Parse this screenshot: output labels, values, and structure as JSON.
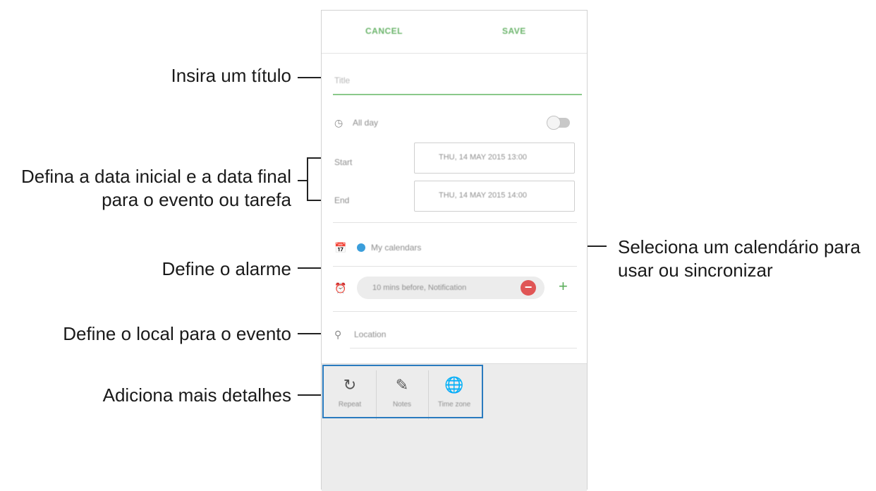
{
  "callouts": {
    "title": "Insira um título",
    "dates_line1": "Defina a data inicial e a data final",
    "dates_line2": "para o evento ou tarefa",
    "calendar_line1": "Seleciona um calendário para",
    "calendar_line2": "usar ou sincronizar",
    "alarm": "Define o alarme",
    "location": "Define o local para o evento",
    "details": "Adiciona mais detalhes"
  },
  "app": {
    "cancel_label": "CANCEL",
    "save_label": "SAVE",
    "title_placeholder": "Title",
    "all_day_label": "All day",
    "all_day_on": false,
    "start_label": "Start",
    "start_value": "THU, 14 MAY 2015  13:00",
    "end_label": "End",
    "end_value": "THU, 14 MAY 2015  14:00",
    "calendar_label": "My calendars",
    "reminder_value": "10 mins before, Notification",
    "location_placeholder": "Location",
    "details": [
      {
        "label": "Repeat",
        "icon": "repeat-icon"
      },
      {
        "label": "Notes",
        "icon": "notes-icon"
      },
      {
        "label": "Time zone",
        "icon": "timezone-icon"
      }
    ]
  },
  "colors": {
    "accent_green": "#6ab46a",
    "calendar_blue": "#3b9edb",
    "remove_red": "#e05555",
    "highlight_blue": "#2a7bbf"
  }
}
